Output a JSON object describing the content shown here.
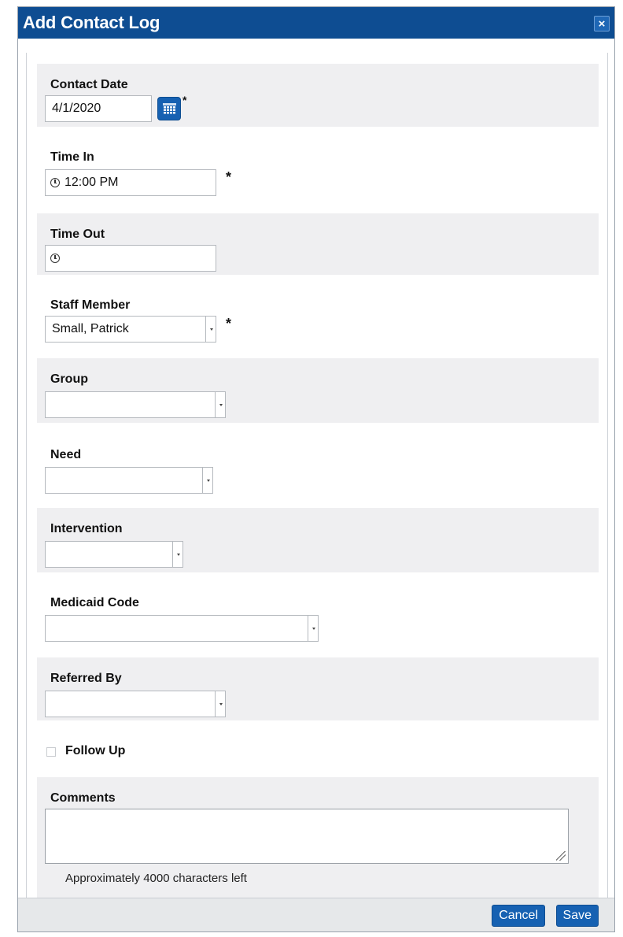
{
  "dialog": {
    "title": "Add Contact Log",
    "close_label": "×"
  },
  "fields": {
    "contact_date": {
      "label": "Contact Date",
      "value": "4/1/2020",
      "required_mark": "*"
    },
    "time_in": {
      "label": "Time In",
      "value": "12:00 PM",
      "required_mark": "*"
    },
    "time_out": {
      "label": "Time Out",
      "value": ""
    },
    "staff_member": {
      "label": "Staff Member",
      "value": "Small, Patrick",
      "required_mark": "*"
    },
    "group": {
      "label": "Group",
      "value": ""
    },
    "need": {
      "label": "Need",
      "value": ""
    },
    "intervention": {
      "label": "Intervention",
      "value": ""
    },
    "medicaid_code": {
      "label": "Medicaid Code",
      "value": ""
    },
    "referred_by": {
      "label": "Referred By",
      "value": ""
    },
    "follow_up": {
      "label": "Follow Up",
      "checked": false
    },
    "comments": {
      "label": "Comments",
      "value": "",
      "helper": "Approximately 4000 characters left"
    }
  },
  "footer": {
    "cancel_label": "Cancel",
    "save_label": "Save"
  },
  "colors": {
    "title_bar": "#0e4d92",
    "button": "#1661b2",
    "shaded_row": "#efeff1"
  },
  "icons": {
    "calendar": "calendar-icon",
    "clock": "clock-icon",
    "close": "close-icon",
    "resize": "resize-grip-icon"
  }
}
